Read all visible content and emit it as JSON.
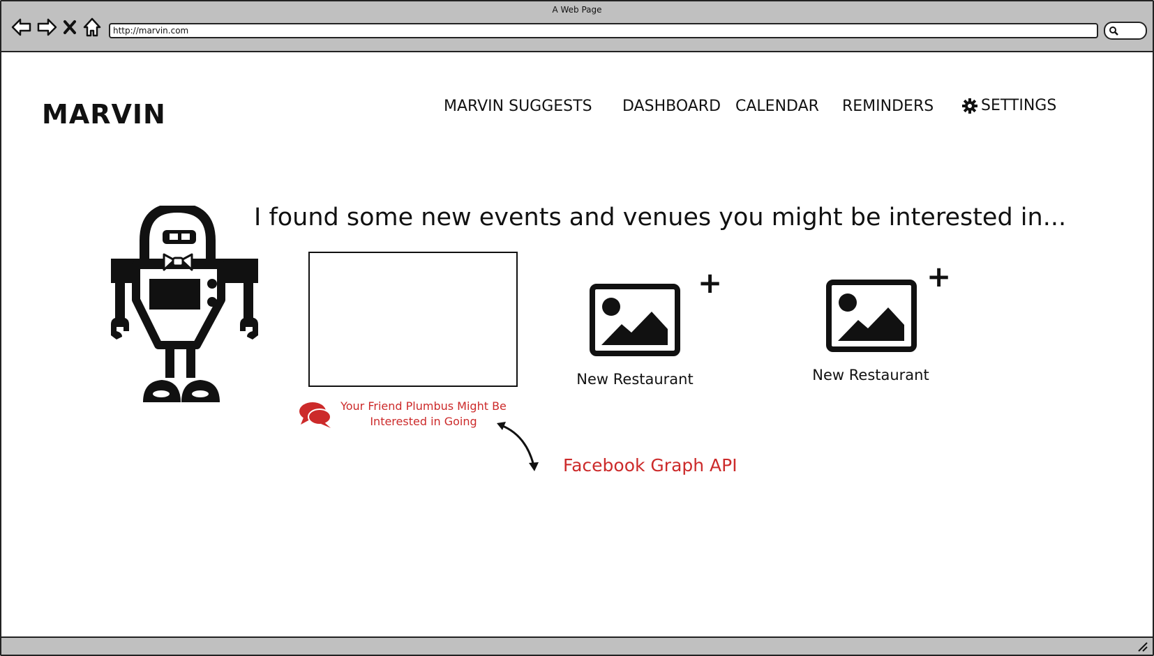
{
  "window": {
    "title": "A Web Page",
    "url": "http://marvin.com",
    "nav_icons": [
      "back-arrow-icon",
      "forward-arrow-icon",
      "close-icon",
      "home-icon"
    ],
    "search_icon": "search-icon"
  },
  "header": {
    "brand": "MARVIN",
    "nav": [
      {
        "label": "MARVIN SUGGESTS"
      },
      {
        "label": "DASHBOARD"
      },
      {
        "label": "CALENDAR"
      },
      {
        "label": "REMINDERS"
      },
      {
        "label": "SETTINGS",
        "icon": "gear-icon"
      }
    ]
  },
  "main": {
    "headline": "I found some new events and venues you might be interested in...",
    "mascot_icon": "robot-icon",
    "event_card": {
      "friend_note": "Your Friend Plumbus Might Be Interested in Going",
      "friend_icon": "chat-bubbles-icon"
    },
    "annotation": "Facebook Graph API",
    "suggestions": [
      {
        "label": "New Restaurant",
        "icon": "image-icon",
        "action": "+"
      },
      {
        "label": "New Restaurant",
        "icon": "image-icon",
        "action": "+"
      }
    ]
  },
  "colors": {
    "accent_red": "#cc2a2a",
    "chrome_gray": "#c0c0c0",
    "ink": "#111111"
  }
}
